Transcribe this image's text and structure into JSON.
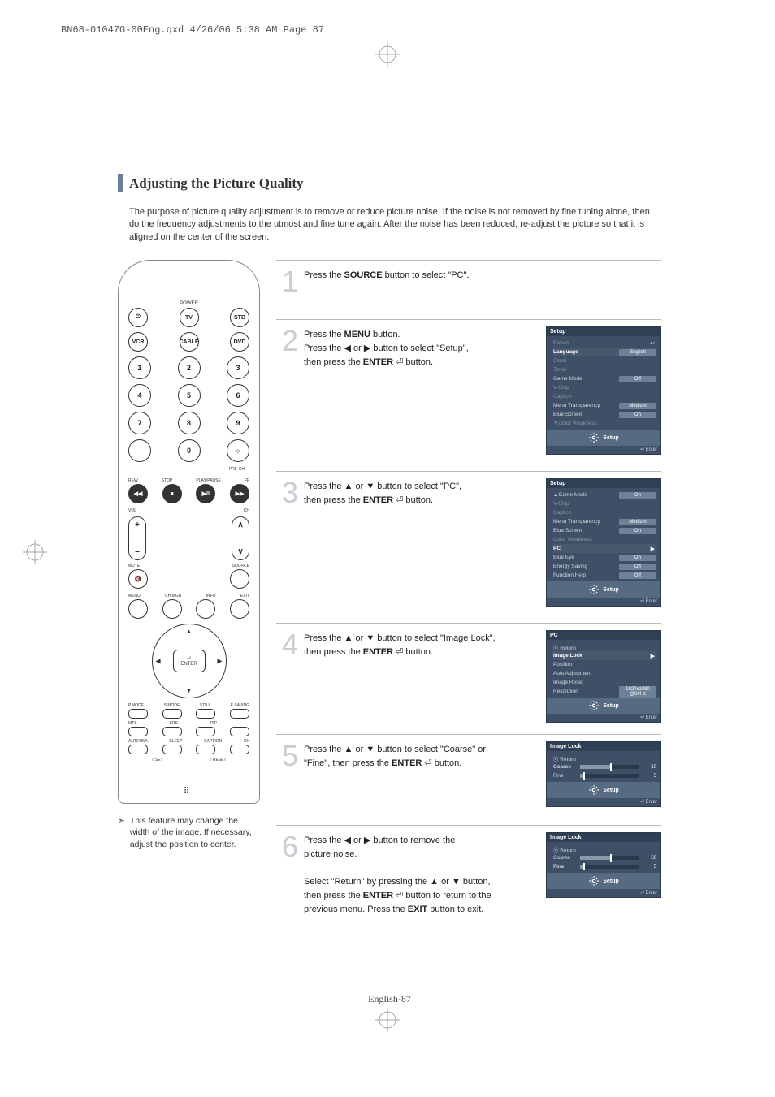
{
  "header_line": "BN68-01047G-00Eng.qxd  4/26/06  5:38 AM  Page 87",
  "title": "Adjusting the Picture Quality",
  "intro": "The purpose of picture quality adjustment is to remove or reduce picture noise. If the noise is not removed by fine tuning alone, then do the frequency adjustments to the utmost and fine tune again. After the noise has been reduced, re-adjust the picture so that it is aligned on the center of the screen.",
  "note": "This feature may change the width of the image. If necessary, adjust the position to center.",
  "remote": {
    "top_label": "POWER",
    "row1": [
      "⏻",
      "TV",
      "STB"
    ],
    "row2": [
      "VCR",
      "CABLE",
      "DVD"
    ],
    "numrows": [
      [
        "1",
        "2",
        "3"
      ],
      [
        "4",
        "5",
        "6"
      ],
      [
        "7",
        "8",
        "9"
      ],
      [
        "–",
        "0",
        "○"
      ]
    ],
    "prech": "PRE-CH",
    "transport_labels": [
      "REW",
      "STOP",
      "PLAY/PAUSE",
      "FF"
    ],
    "transport": [
      "◀◀",
      "■",
      "▶II",
      "▶▶"
    ],
    "vol": "VOL",
    "ch": "CH",
    "mute": "MUTE",
    "source": "SOURCE",
    "menu_row_labels": [
      "MENU",
      "CH MGR",
      "INFO",
      "EXIT"
    ],
    "enter": "ENTER",
    "bottom_labels1": [
      "P.MODE",
      "S.MODE",
      "STILL",
      "E.SAVING"
    ],
    "bottom_labels2": [
      "MTS",
      "SRS",
      "PIP",
      ""
    ],
    "bottom_labels3": [
      "ANTENNA",
      "SLEEP",
      "CAPTION",
      "CH"
    ],
    "set": "○ SET",
    "reset": "○ RESET"
  },
  "steps": [
    {
      "num": "1",
      "text": "Press the <b>SOURCE</b> button to select \"PC\"."
    },
    {
      "num": "2",
      "text": "Press the <b>MENU</b> button.<br>Press the <span class='glyph'>◀</span> or <span class='glyph'>▶</span> button to select \"Setup\",<br>then press  the <b>ENTER</b> <span class='glyph'>⏎</span> button."
    },
    {
      "num": "3",
      "text": "Press the <span class='glyph'>▲</span> or <span class='glyph'>▼</span> button to select \"PC\",<br>then press the <b>ENTER</b> <span class='glyph'>⏎</span> button."
    },
    {
      "num": "4",
      "text": "Press the <span class='glyph'>▲</span> or <span class='glyph'>▼</span> button to select \"Image Lock\",<br>then press the <b>ENTER</b> <span class='glyph'>⏎</span> button."
    },
    {
      "num": "5",
      "text": "Press the <span class='glyph'>▲</span> or <span class='glyph'>▼</span> button to select \"Coarse\" or<br>\"Fine\", then press the <b>ENTER</b> <span class='glyph'>⏎</span> button."
    },
    {
      "num": "6",
      "text": "Press the <span class='glyph'>◀</span> or <span class='glyph'>▶</span>  button to remove the<br>picture noise.<br><br>Select \"Return\" by pressing the <span class='glyph'>▲</span> or <span class='glyph'>▼</span> button,<br>then press the <b>ENTER</b> <span class='glyph'>⏎</span> button to return to the<br>previous menu. Press the <b>EXIT</b> button to exit."
    }
  ],
  "osd2": {
    "title": "Setup",
    "rows": [
      {
        "l": "Return",
        "dim": true,
        "arrow": "↩"
      },
      {
        "l": "Language",
        "v": "English",
        "hl": true
      },
      {
        "l": "Clock",
        "dim": true
      },
      {
        "l": "Timer",
        "dim": true
      },
      {
        "l": "Game Mode",
        "v": "Off"
      },
      {
        "l": "V-Chip",
        "dim": true
      },
      {
        "l": "Caption",
        "dim": true
      },
      {
        "l": "Menu Transparency",
        "v": "Medium"
      },
      {
        "l": "Blue Screen",
        "v": "On"
      },
      {
        "l": "▼Color Weakness",
        "dim": true
      }
    ],
    "footer": "Setup",
    "enter": "⏎ Enter"
  },
  "osd3": {
    "title": "Setup",
    "rows": [
      {
        "l": "▲Game Mode",
        "v": "On"
      },
      {
        "l": "V-Chip",
        "dim": true
      },
      {
        "l": "Caption",
        "dim": true
      },
      {
        "l": "Menu Transparency",
        "v": "Medium"
      },
      {
        "l": "Blue Screen",
        "v": "On"
      },
      {
        "l": "Color Weakness",
        "dim": true
      },
      {
        "l": "PC",
        "hl": true,
        "arrow": "▶"
      },
      {
        "l": "Blue Eye",
        "v": "On"
      },
      {
        "l": "Energy Saving",
        "v": "Off"
      },
      {
        "l": "Function Help",
        "v": "Off"
      }
    ],
    "footer": "Setup",
    "enter": "⏎ Enter"
  },
  "osd4": {
    "title": "PC",
    "rows": [
      {
        "l": "⦿ Return"
      },
      {
        "l": "Image Lock",
        "hl": true,
        "arrow": "▶"
      },
      {
        "l": "Position"
      },
      {
        "l": "Auto Adjustment"
      },
      {
        "l": "Image Reset"
      },
      {
        "l": "Resolution",
        "v": "1920x1080 @60Hz"
      }
    ],
    "footer": "Setup",
    "enter": "⏎ Enter"
  },
  "osd5": {
    "title": "Image Lock",
    "rows": [
      {
        "l": "⦿ Return"
      }
    ],
    "sliders": [
      {
        "l": "Coarse",
        "val": "50",
        "pct": 50,
        "hl": true
      },
      {
        "l": "Fine",
        "val": "5",
        "pct": 5
      }
    ],
    "footer": "Setup",
    "enter": "⏎ Enter"
  },
  "osd6": {
    "title": "Image Lock",
    "rows": [
      {
        "l": "⦿ Return"
      }
    ],
    "sliders": [
      {
        "l": "Coarse",
        "val": "50",
        "pct": 50
      },
      {
        "l": "Fine",
        "val": "5",
        "pct": 5,
        "hl": true
      }
    ],
    "footer": "Setup",
    "enter": "⏎ Enter"
  },
  "footer": "English-87"
}
